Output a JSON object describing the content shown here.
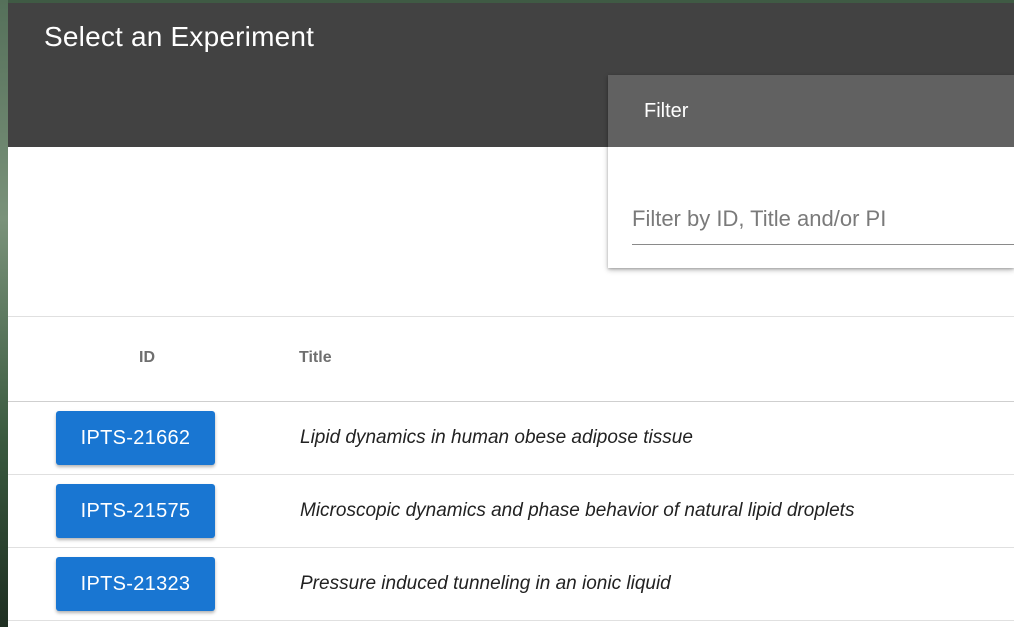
{
  "header": {
    "title": "Select an Experiment"
  },
  "filter": {
    "title": "Filter",
    "placeholder": "Filter by ID, Title and/or PI",
    "value": ""
  },
  "table": {
    "columns": {
      "id": "ID",
      "title": "Title"
    },
    "rows": [
      {
        "id": "IPTS-21662",
        "title": "Lipid dynamics in human obese adipose tissue"
      },
      {
        "id": "IPTS-21575",
        "title": "Microscopic dynamics and phase behavior of natural lipid droplets"
      },
      {
        "id": "IPTS-21323",
        "title": "Pressure induced tunneling in an ionic liquid"
      }
    ]
  },
  "colors": {
    "header_bg": "#424242",
    "filter_header_bg": "#616161",
    "accent": "#1976d2"
  }
}
